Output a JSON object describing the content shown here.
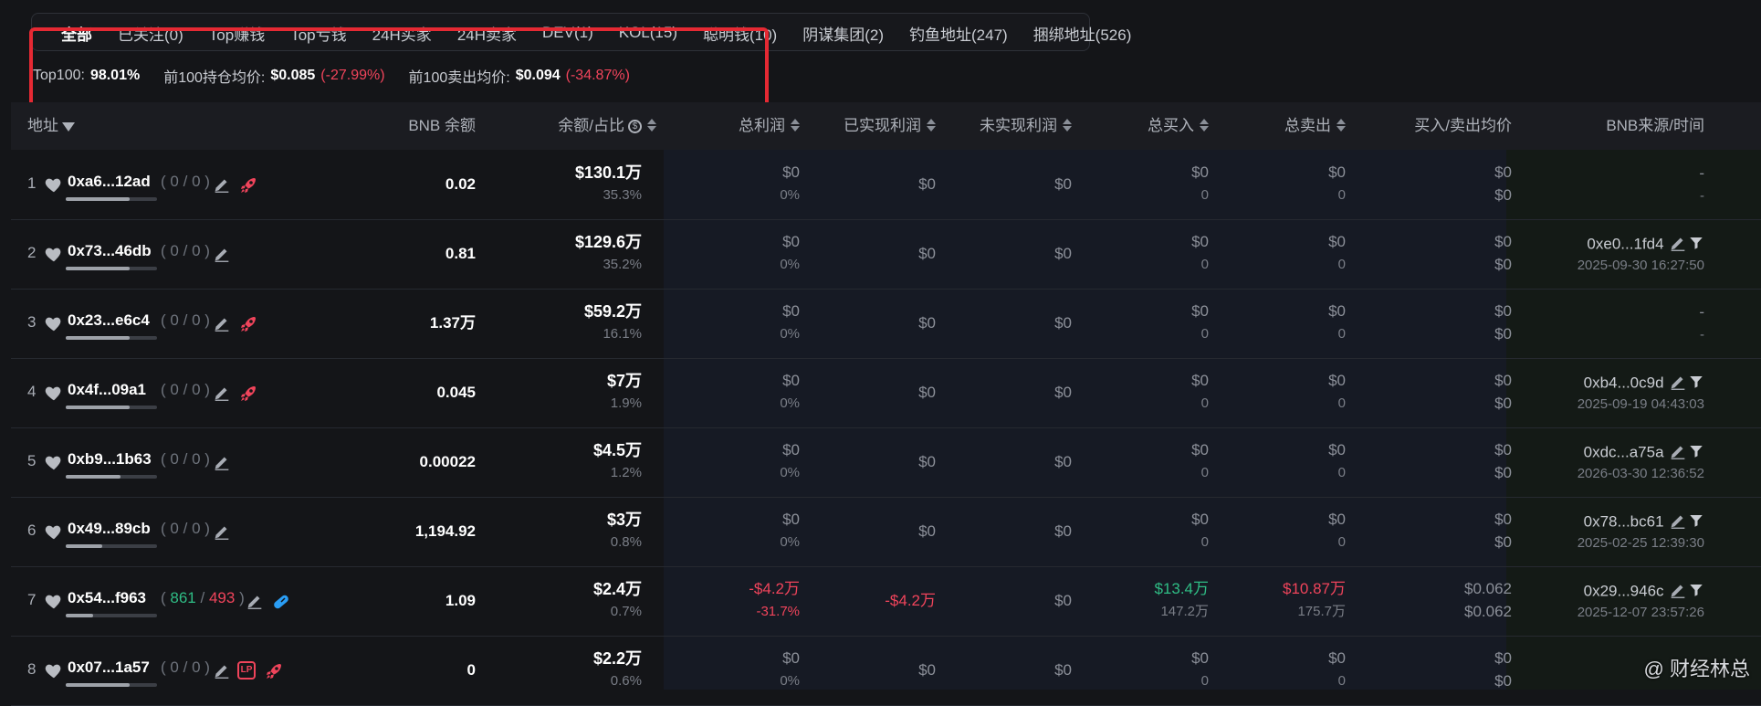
{
  "tabs": [
    {
      "label": "全部",
      "active": true
    },
    {
      "label": "已关注(0)"
    },
    {
      "label": "Top赚钱"
    },
    {
      "label": "Top亏钱"
    },
    {
      "label": "24H买家"
    },
    {
      "label": "24H卖家"
    },
    {
      "label": "DEV(1)"
    },
    {
      "label": "KOL(15)"
    },
    {
      "label": "聪明钱(10)"
    },
    {
      "label": "阴谋集团(2)"
    },
    {
      "label": "钓鱼地址(247)"
    },
    {
      "label": "捆绑地址(526)"
    }
  ],
  "stats": {
    "top100_label": "Top100:",
    "top100_value": "98.01%",
    "hold_label": "前100持仓均价:",
    "hold_value": "$0.085",
    "hold_change": "(-27.99%)",
    "sell_label": "前100卖出均价:",
    "sell_value": "$0.094",
    "sell_change": "(-34.87%)"
  },
  "columns": {
    "address": "地址",
    "bnb_balance": "BNB 余额",
    "balance_pct": "余额/占比",
    "total_profit": "总利润",
    "realized": "已实现利润",
    "unrealized": "未实现利润",
    "total_buy": "总买入",
    "total_sell": "总卖出",
    "avg_price": "买入/卖出均价",
    "bnb_source": "BNB来源/时间"
  },
  "colors": {
    "accent_red": "#f0445b",
    "accent_green": "#2fbd85",
    "highlight_box": "#e52933"
  },
  "rows": [
    {
      "rank": "1",
      "addr": "0xa6...12ad",
      "tx_in": "0",
      "tx_sep": "/",
      "tx_out": "0",
      "holding": 0.7,
      "icon": "rocket-icon",
      "bnb": "0.02",
      "bal": "$130.1万",
      "pct": "35.3%",
      "tp1": "$0",
      "tp2": "0%",
      "realized": "$0",
      "unrealized": "$0",
      "buy1": "$0",
      "buy2": "0",
      "sell1": "$0",
      "sell2": "0",
      "avg1": "$0",
      "avg2": "$0",
      "src": "-",
      "time": "-"
    },
    {
      "rank": "2",
      "addr": "0x73...46db",
      "tx_in": "0",
      "tx_sep": "/",
      "tx_out": "0",
      "holding": 0.7,
      "icon": "",
      "bnb": "0.81",
      "bal": "$129.6万",
      "pct": "35.2%",
      "tp1": "$0",
      "tp2": "0%",
      "realized": "$0",
      "unrealized": "$0",
      "buy1": "$0",
      "buy2": "0",
      "sell1": "$0",
      "sell2": "0",
      "avg1": "$0",
      "avg2": "$0",
      "src": "0xe0...1fd4",
      "time": "2025-09-30 16:27:50"
    },
    {
      "rank": "3",
      "addr": "0x23...e6c4",
      "tx_in": "0",
      "tx_sep": "/",
      "tx_out": "0",
      "holding": 0.7,
      "icon": "rocket-icon",
      "bnb": "1.37万",
      "bal": "$59.2万",
      "pct": "16.1%",
      "tp1": "$0",
      "tp2": "0%",
      "realized": "$0",
      "unrealized": "$0",
      "buy1": "$0",
      "buy2": "0",
      "sell1": "$0",
      "sell2": "0",
      "avg1": "$0",
      "avg2": "$0",
      "src": "-",
      "time": "-"
    },
    {
      "rank": "4",
      "addr": "0x4f...09a1",
      "tx_in": "0",
      "tx_sep": "/",
      "tx_out": "0",
      "holding": 0.7,
      "icon": "rocket-icon",
      "bnb": "0.045",
      "bal": "$7万",
      "pct": "1.9%",
      "tp1": "$0",
      "tp2": "0%",
      "realized": "$0",
      "unrealized": "$0",
      "buy1": "$0",
      "buy2": "0",
      "sell1": "$0",
      "sell2": "0",
      "avg1": "$0",
      "avg2": "$0",
      "src": "0xb4...0c9d",
      "time": "2025-09-19 04:43:03"
    },
    {
      "rank": "5",
      "addr": "0xb9...1b63",
      "tx_in": "0",
      "tx_sep": "/",
      "tx_out": "0",
      "holding": 0.6,
      "icon": "",
      "bnb": "0.00022",
      "bal": "$4.5万",
      "pct": "1.2%",
      "tp1": "$0",
      "tp2": "0%",
      "realized": "$0",
      "unrealized": "$0",
      "buy1": "$0",
      "buy2": "0",
      "sell1": "$0",
      "sell2": "0",
      "avg1": "$0",
      "avg2": "$0",
      "src": "0xdc...a75a",
      "time": "2026-03-30 12:36:52"
    },
    {
      "rank": "6",
      "addr": "0x49...89cb",
      "tx_in": "0",
      "tx_sep": "/",
      "tx_out": "0",
      "holding": 0.4,
      "icon": "",
      "bnb": "1,194.92",
      "bal": "$3万",
      "pct": "0.8%",
      "tp1": "$0",
      "tp2": "0%",
      "realized": "$0",
      "unrealized": "$0",
      "buy1": "$0",
      "buy2": "0",
      "sell1": "$0",
      "sell2": "0",
      "avg1": "$0",
      "avg2": "$0",
      "src": "0x78...bc61",
      "time": "2025-02-25 12:39:30"
    },
    {
      "rank": "7",
      "addr": "0x54...f963",
      "tx_in": "861",
      "tx_sep": "/",
      "tx_out": "493",
      "holding": 0.3,
      "icon": "pill-icon",
      "bnb": "1.09",
      "bal": "$2.4万",
      "pct": "0.7%",
      "tp1": "-$4.2万",
      "tp2": "-31.7%",
      "realized": "-$4.2万",
      "unrealized": "$0",
      "buy1": "$13.4万",
      "buy2": "147.2万",
      "sell1": "$10.87万",
      "sell2": "175.7万",
      "avg1": "$0.062",
      "avg2": "$0.062",
      "src": "0x29...946c",
      "time": "2025-12-07 23:57:26"
    },
    {
      "rank": "8",
      "addr": "0x07...1a57",
      "tx_in": "0",
      "tx_sep": "/",
      "tx_out": "0",
      "holding": 0.7,
      "icon": "rocket-icon",
      "lp": "LP",
      "bnb": "0",
      "bal": "$2.2万",
      "pct": "0.6%",
      "tp1": "$0",
      "tp2": "0%",
      "realized": "$0",
      "unrealized": "$0",
      "buy1": "$0",
      "buy2": "0",
      "sell1": "$0",
      "sell2": "0",
      "avg1": "$0",
      "avg2": "$0",
      "src": "",
      "time": ""
    }
  ],
  "watermark": "@ 财经林总"
}
